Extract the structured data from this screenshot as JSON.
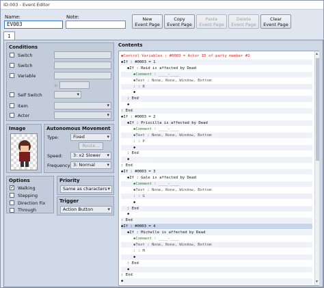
{
  "window": {
    "title": "ID:003 - Event Editor"
  },
  "name_label": "Name:",
  "name_value": "EV003",
  "note_label": "Note:",
  "note_value": "",
  "buttons": {
    "new": "New\nEvent Page",
    "copy": "Copy\nEvent Page",
    "paste": "Paste\nEvent Page",
    "delete": "Delete\nEvent Page",
    "clear": "Clear\nEvent Page"
  },
  "tab": "1",
  "conditions": {
    "title": "Conditions",
    "items": [
      "Switch",
      "Switch",
      "Variable",
      "Self Switch",
      "Item",
      "Actor"
    ],
    "var_symbol": "≥"
  },
  "image": {
    "title": "Image"
  },
  "autonomous": {
    "title": "Autonomous Movement",
    "type_label": "Type:",
    "type_value": "Fixed",
    "route_label": "Route...",
    "speed_label": "Speed:",
    "speed_value": "3: x2 Slower",
    "freq_label": "Frequency:",
    "freq_value": "3: Normal"
  },
  "options": {
    "title": "Options",
    "items": [
      {
        "label": "Walking",
        "checked": true
      },
      {
        "label": "Stepping",
        "checked": false
      },
      {
        "label": "Direction Fix",
        "checked": false
      },
      {
        "label": "Through",
        "checked": false
      }
    ]
  },
  "priority": {
    "title": "Priority",
    "value": "Same as characters"
  },
  "trigger": {
    "title": "Trigger",
    "value": "Action Button"
  },
  "contents": {
    "title": "Contents",
    "lines": [
      {
        "t": "◆Control Variables : #0003 = Actor ID of party member #2",
        "c": "#d22",
        "ind": 0
      },
      {
        "t": "◆If : #0003 = 1",
        "c": "#111",
        "ind": 0
      },
      {
        "t": "◆If : Reid is affected by Dead",
        "c": "#111",
        "ind": 1
      },
      {
        "t": "◆Comment : ____-____",
        "c": "#2a8a2a",
        "ind": 2
      },
      {
        "t": "◆Text : None, None, Window, Bottom",
        "c": "#555",
        "ind": 2
      },
      {
        "t": ":       : R",
        "c": "#555",
        "ind": 2
      },
      {
        "t": "◆",
        "c": "#111",
        "ind": 2
      },
      {
        "t": ": End",
        "c": "#111",
        "ind": 1
      },
      {
        "t": "◆",
        "c": "#111",
        "ind": 1
      },
      {
        "t": ": End",
        "c": "#111",
        "ind": 0
      },
      {
        "t": "◆If : #0003 = 2",
        "c": "#111",
        "ind": 0
      },
      {
        "t": "◆If : Priscilla is affected by Dead",
        "c": "#111",
        "ind": 1
      },
      {
        "t": "◆Comment : ____-____",
        "c": "#2a8a2a",
        "ind": 2
      },
      {
        "t": "◆Text : None, None, Window, Bottom",
        "c": "#555",
        "ind": 2
      },
      {
        "t": ":       : P",
        "c": "#555",
        "ind": 2
      },
      {
        "t": "◆",
        "c": "#111",
        "ind": 2
      },
      {
        "t": ": End",
        "c": "#111",
        "ind": 1
      },
      {
        "t": "◆",
        "c": "#111",
        "ind": 1
      },
      {
        "t": ": End",
        "c": "#111",
        "ind": 0
      },
      {
        "t": "◆If : #0003 = 3",
        "c": "#111",
        "ind": 0
      },
      {
        "t": "◆If : Gale is affected by Dead",
        "c": "#111",
        "ind": 1
      },
      {
        "t": "◆Comment : ____-____",
        "c": "#2a8a2a",
        "ind": 2
      },
      {
        "t": "◆Text : None, None, Window, Bottom",
        "c": "#555",
        "ind": 2
      },
      {
        "t": ":       : G",
        "c": "#555",
        "ind": 2
      },
      {
        "t": "◆",
        "c": "#111",
        "ind": 2
      },
      {
        "t": ": End",
        "c": "#111",
        "ind": 1
      },
      {
        "t": "◆",
        "c": "#111",
        "ind": 1
      },
      {
        "t": ": End",
        "c": "#111",
        "ind": 0
      },
      {
        "t": "◆If : #0003 = 4",
        "c": "#111",
        "ind": 0
      },
      {
        "t": "◆If : Michelle is affected by Dead",
        "c": "#111",
        "ind": 1
      },
      {
        "t": "◆Comment : ____-____",
        "c": "#2a8a2a",
        "ind": 2
      },
      {
        "t": "◆Text : None, None, Window, Bottom",
        "c": "#555",
        "ind": 2
      },
      {
        "t": ":       : M",
        "c": "#555",
        "ind": 2
      },
      {
        "t": "◆",
        "c": "#111",
        "ind": 2
      },
      {
        "t": ": End",
        "c": "#111",
        "ind": 1
      },
      {
        "t": "◆",
        "c": "#111",
        "ind": 1
      },
      {
        "t": ": End",
        "c": "#111",
        "ind": 0
      },
      {
        "t": "◆",
        "c": "#111",
        "ind": 0
      }
    ]
  }
}
